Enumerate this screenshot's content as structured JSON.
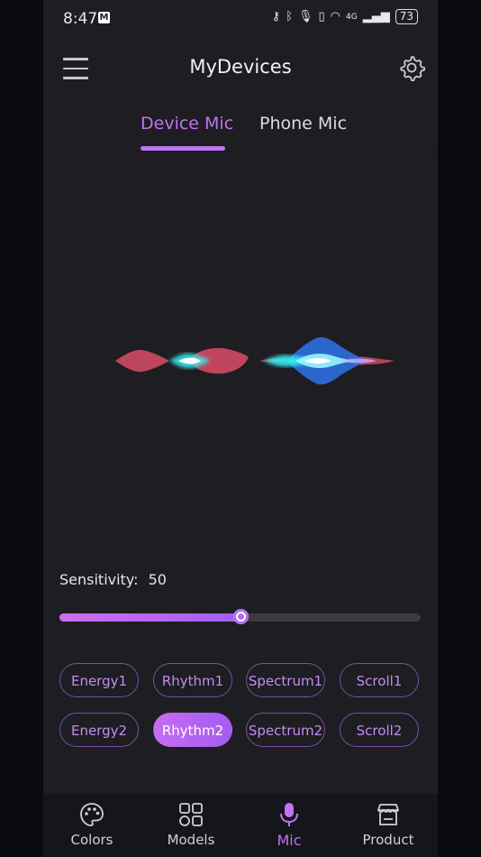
{
  "status": {
    "time": "8:47",
    "notification_icon": "gmail-icon",
    "battery": "73",
    "network": "4G"
  },
  "header": {
    "title": "MyDevices",
    "menu_icon": "hamburger-menu-icon",
    "settings_icon": "gear-icon"
  },
  "tabs": [
    {
      "label": "Device Mic",
      "active": true
    },
    {
      "label": "Phone Mic",
      "active": false
    }
  ],
  "sensitivity": {
    "label": "Sensitivity:",
    "value": "50",
    "level_percent": 50
  },
  "modes": [
    {
      "label": "Energy1",
      "selected": false
    },
    {
      "label": "Rhythm1",
      "selected": false
    },
    {
      "label": "Spectrum1",
      "selected": false
    },
    {
      "label": "Scroll1",
      "selected": false
    },
    {
      "label": "Energy2",
      "selected": false
    },
    {
      "label": "Rhythm2",
      "selected": true
    },
    {
      "label": "Spectrum2",
      "selected": false
    },
    {
      "label": "Scroll2",
      "selected": false
    }
  ],
  "bottom_nav": [
    {
      "label": "Colors",
      "icon": "palette-icon",
      "active": false
    },
    {
      "label": "Models",
      "icon": "grid-icon",
      "active": false
    },
    {
      "label": "Mic",
      "icon": "microphone-icon",
      "active": true
    },
    {
      "label": "Product",
      "icon": "store-icon",
      "active": false
    }
  ],
  "colors": {
    "accent": "#c173f3",
    "background": "#1d1d22",
    "wave_red": "#d24a63",
    "wave_cyan": "#38f0f0",
    "wave_blue": "#2d6fe0"
  }
}
